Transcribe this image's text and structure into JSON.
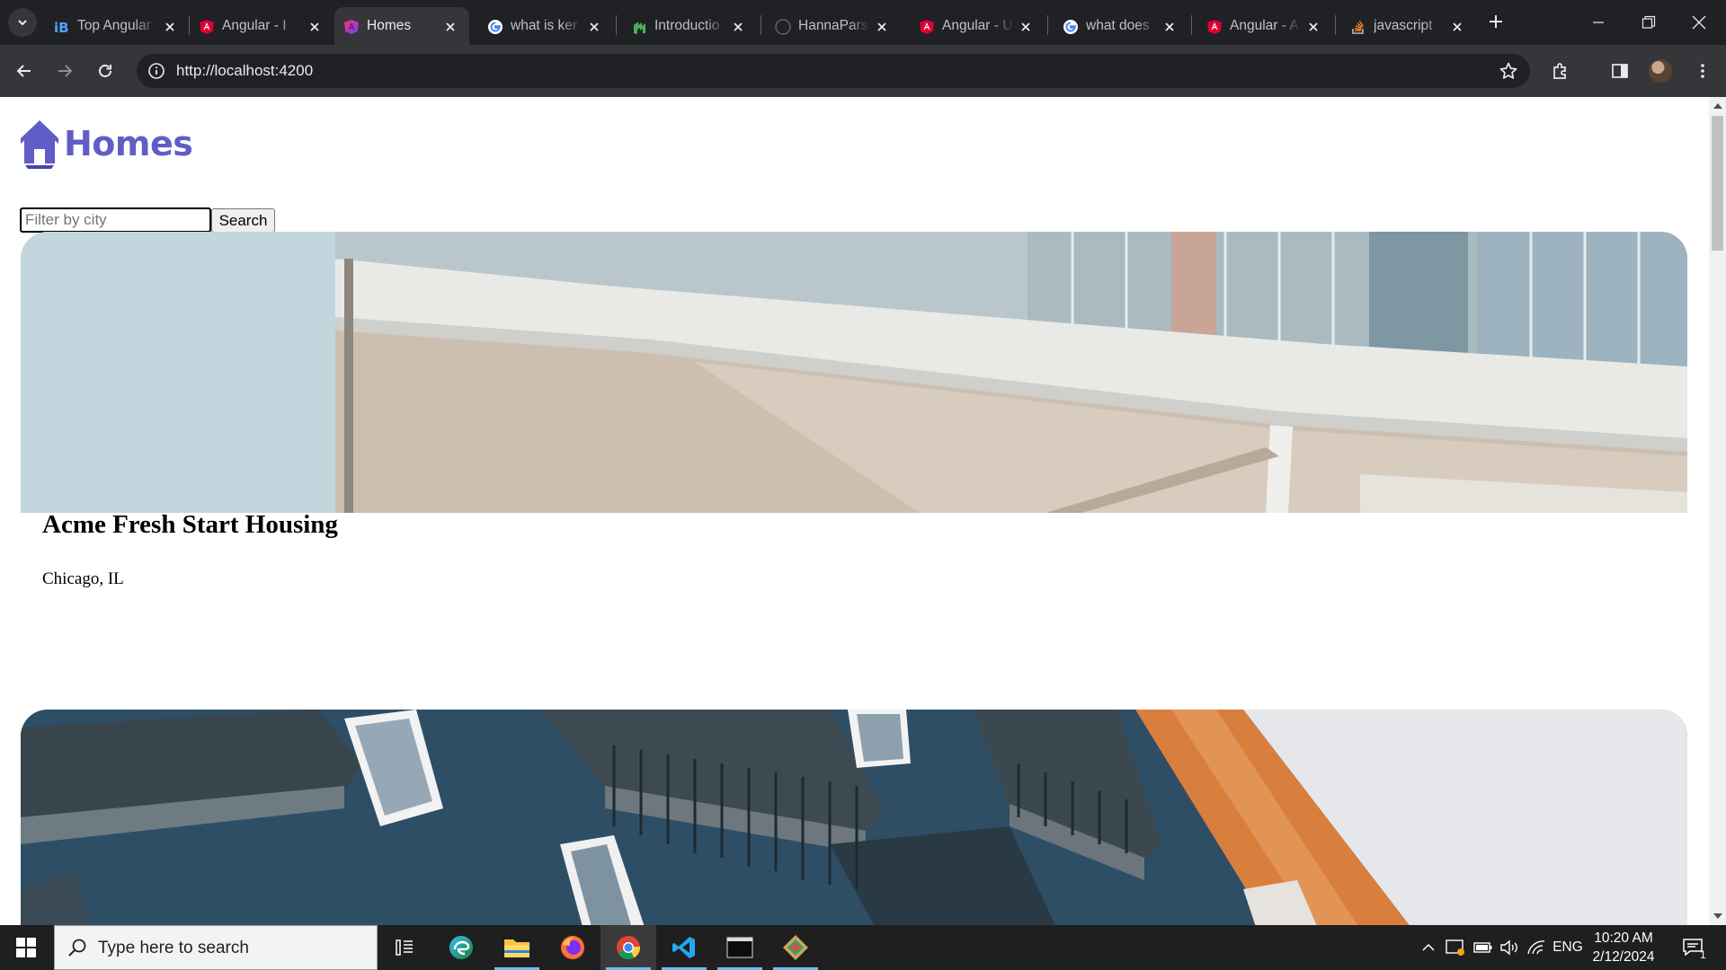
{
  "browser": {
    "tabs": [
      {
        "title": "Top Angular",
        "favicon": "ib-icon",
        "active": false
      },
      {
        "title": "Angular - I",
        "favicon": "angular-icon",
        "active": false
      },
      {
        "title": "Homes",
        "favicon": "angular-dev-icon",
        "active": true
      },
      {
        "title": "what is ker",
        "favicon": "google-icon",
        "active": false
      },
      {
        "title": "Introductio",
        "favicon": "green-logo-icon",
        "active": false
      },
      {
        "title": "HannaPars",
        "favicon": "github-icon",
        "active": false
      },
      {
        "title": "Angular - U",
        "favicon": "angular-icon",
        "active": false
      },
      {
        "title": "what does",
        "favicon": "google-icon",
        "active": false
      },
      {
        "title": "Angular - A",
        "favicon": "angular-icon",
        "active": false
      },
      {
        "title": "javascript",
        "favicon": "stackoverflow-icon",
        "active": false
      }
    ],
    "url": "http://localhost:4200"
  },
  "page": {
    "brand": "Homes",
    "filter_placeholder": "Filter by city",
    "search_label": "Search",
    "listings": [
      {
        "name": "Acme Fresh Start Housing",
        "location": "Chicago, IL"
      },
      {
        "name": "",
        "location": ""
      }
    ]
  },
  "taskbar": {
    "search_placeholder": "Type here to search",
    "apps": [
      "task-view",
      "edge",
      "file-explorer",
      "firefox",
      "chrome",
      "vscode",
      "terminal",
      "git"
    ],
    "language": "ENG",
    "time": "10:20 AM",
    "date": "2/12/2024",
    "notifications": "1"
  },
  "colors": {
    "brand": "#605dc8",
    "chrome_dark": "#202124",
    "chrome_toolbar": "#35363a"
  }
}
